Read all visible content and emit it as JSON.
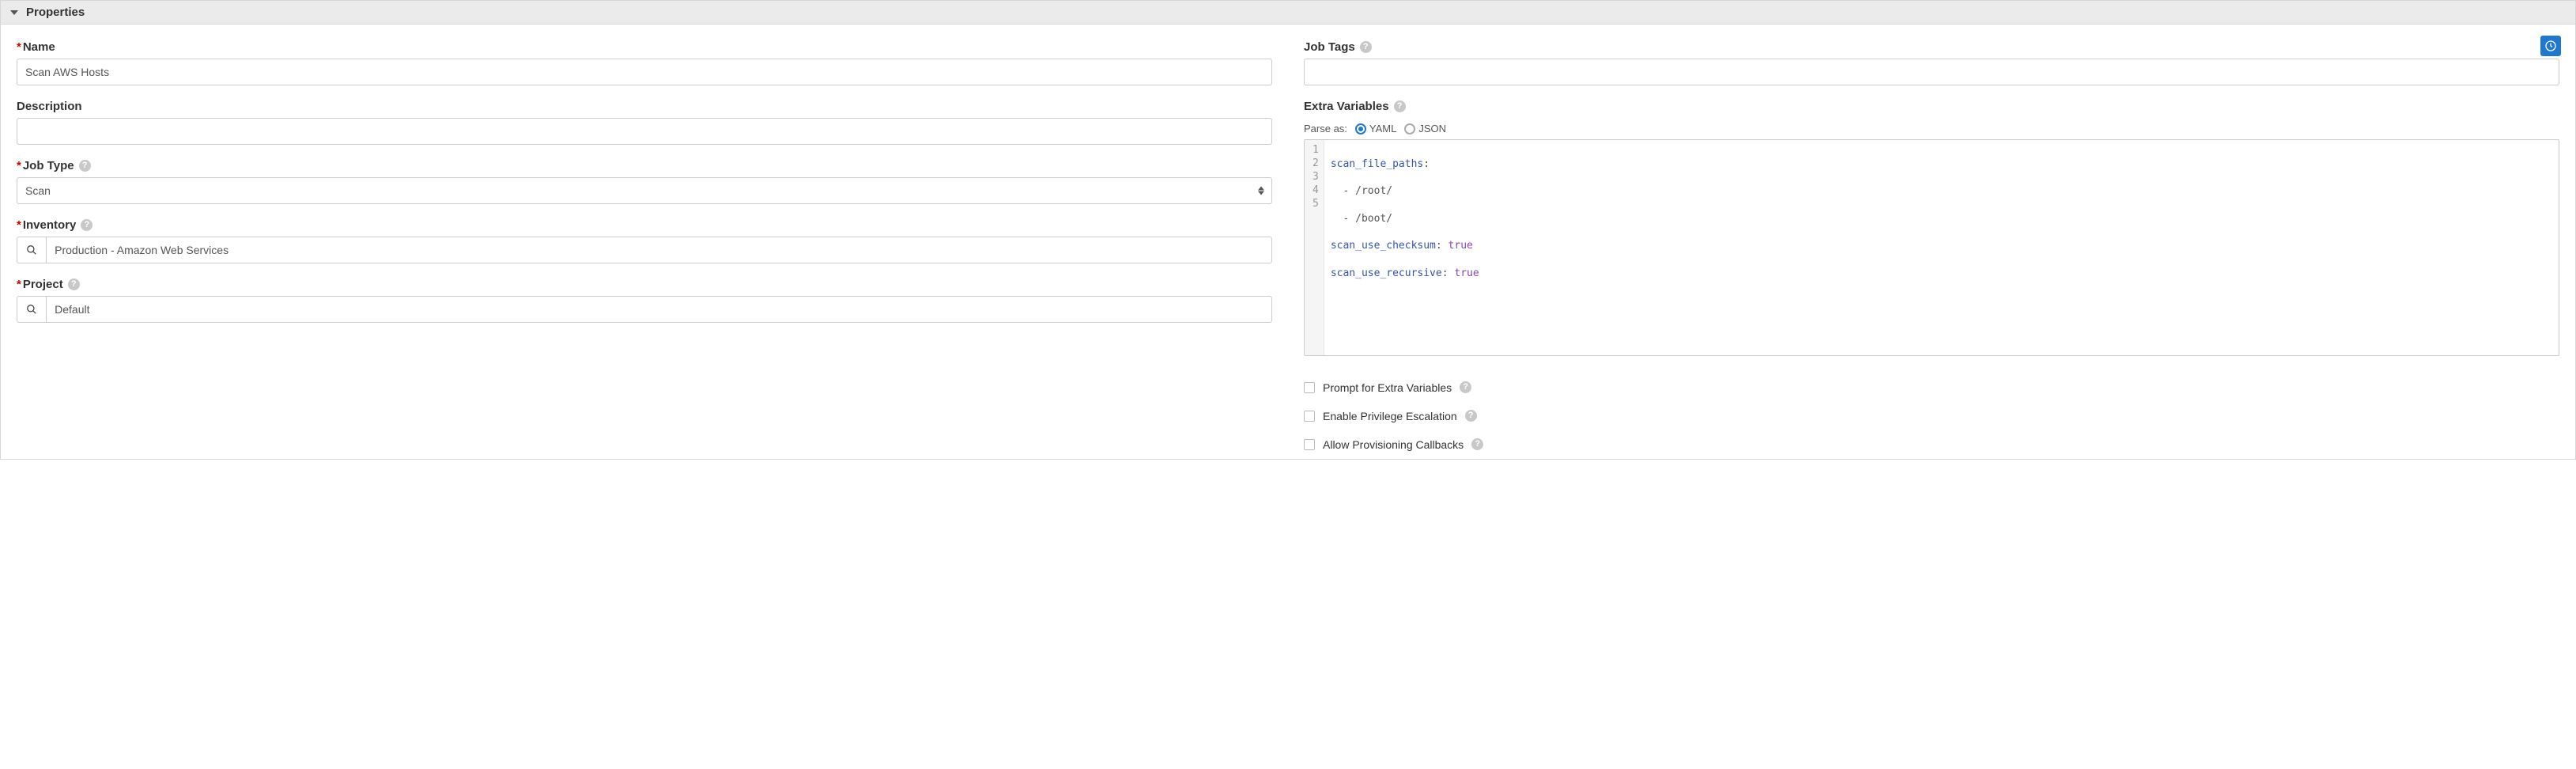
{
  "panel": {
    "title": "Properties"
  },
  "left": {
    "name_label": "Name",
    "name_value": "Scan AWS Hosts",
    "description_label": "Description",
    "description_value": "",
    "job_type_label": "Job Type",
    "job_type_value": "Scan",
    "inventory_label": "Inventory",
    "inventory_value": "Production - Amazon Web Services",
    "project_label": "Project",
    "project_value": "Default"
  },
  "right": {
    "job_tags_label": "Job Tags",
    "job_tags_value": "",
    "extra_vars_label": "Extra Variables",
    "parse_as_label": "Parse as:",
    "parse_yaml": "YAML",
    "parse_json": "JSON",
    "code_lines": {
      "l1_key": "scan_file_paths",
      "l2": "  - /root/",
      "l3": "  - /boot/",
      "l4_key": "scan_use_checksum",
      "l4_val": "true",
      "l5_key": "scan_use_recursive",
      "l5_val": "true"
    },
    "prompt_label": "Prompt for Extra Variables",
    "escalation_label": "Enable Privilege Escalation",
    "callbacks_label": "Allow Provisioning Callbacks"
  }
}
